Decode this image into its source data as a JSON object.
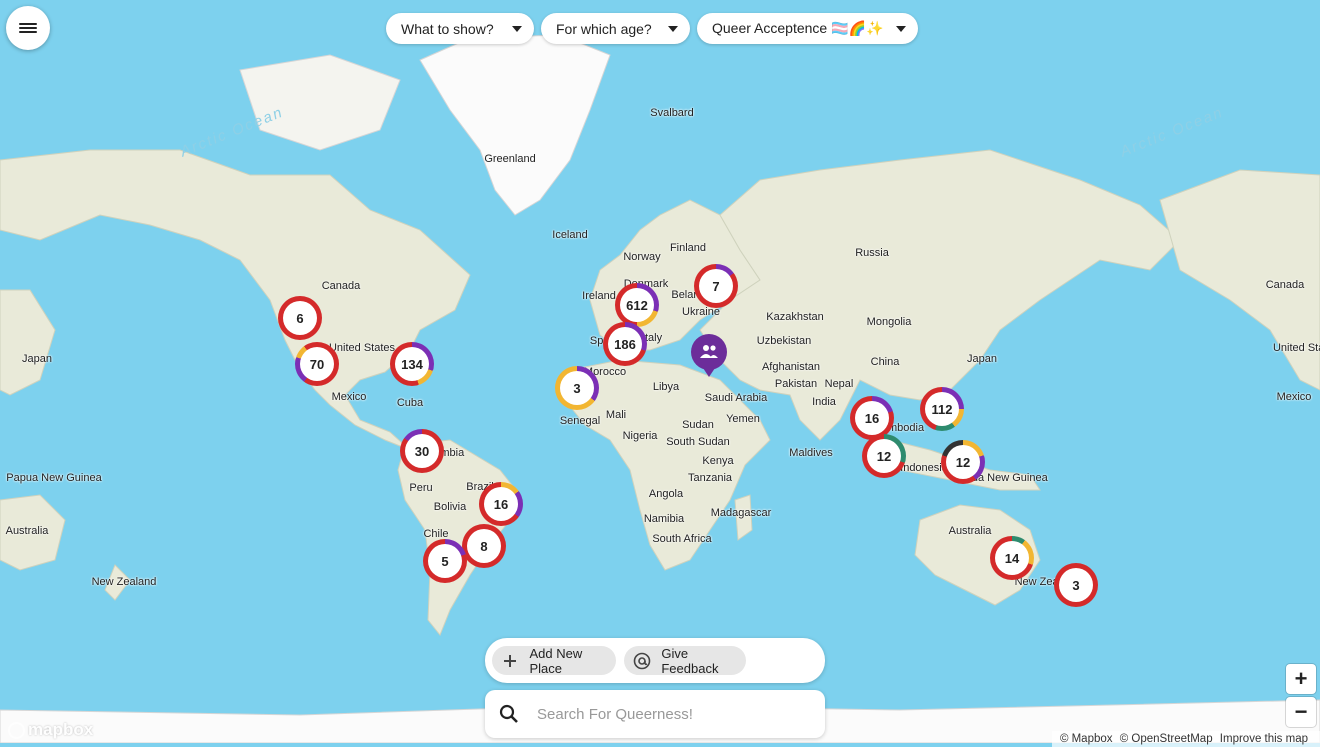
{
  "menu": {
    "icon": "hamburger-icon"
  },
  "filters": [
    {
      "label": "What to show?"
    },
    {
      "label": "For which age?"
    },
    {
      "label": "Queer Acceptence 🏳️‍⚧️🌈✨"
    }
  ],
  "oceans": [
    "Arctic Ocean",
    "Arctic Ocean"
  ],
  "places": [
    "Greenland",
    "Svalbard",
    "Iceland",
    "Norway",
    "Finland",
    "Denmark",
    "Ireland",
    "Belarus",
    "Ukraine",
    "Italy",
    "Spain",
    "Morocco",
    "Libya",
    "Mali",
    "Senegal",
    "Nigeria",
    "Sudan",
    "South Sudan",
    "Kenya",
    "Tanzania",
    "Angola",
    "Namibia",
    "Madagascar",
    "South Africa",
    "Saudi Arabia",
    "Yemen",
    "Kazakhstan",
    "Uzbekistan",
    "Afghanistan",
    "Pakistan",
    "Nepal",
    "India",
    "Maldives",
    "Russia",
    "Mongolia",
    "China",
    "Japan",
    "Cambodia",
    "Indonesia",
    "Papua New Guinea",
    "Australia",
    "New Zealand",
    "Canada",
    "United States",
    "Mexico",
    "Cuba",
    "Peru",
    "Brazil",
    "Bolivia",
    "Chile",
    "Colombia",
    "Papua New Guinea",
    "Australia",
    "Japan",
    "Canada",
    "United States",
    "Mexico",
    "New Zealand"
  ],
  "clusters": [
    {
      "count": "6"
    },
    {
      "count": "70"
    },
    {
      "count": "134"
    },
    {
      "count": "30"
    },
    {
      "count": "16"
    },
    {
      "count": "8"
    },
    {
      "count": "5"
    },
    {
      "count": "3"
    },
    {
      "count": "612"
    },
    {
      "count": "186"
    },
    {
      "count": "7"
    },
    {
      "count": "16"
    },
    {
      "count": "12"
    },
    {
      "count": "112"
    },
    {
      "count": "12"
    },
    {
      "count": "14"
    },
    {
      "count": "3"
    }
  ],
  "group_marker": {
    "icon": "group-icon"
  },
  "actions": {
    "add_label": "Add New Place",
    "feedback_label": "Give Feedback"
  },
  "search": {
    "placeholder": "Search For Queerness!"
  },
  "zoom": {
    "in": "+",
    "out": "−"
  },
  "branding": {
    "logo": "mapbox"
  },
  "attribution": [
    "© Mapbox",
    "© OpenStreetMap",
    "Improve this map"
  ],
  "colors": {
    "ocean": "#7dd1ee",
    "land": "#e9ead9",
    "ice": "#fbfbfb",
    "cluster_ring": "#d42a2a",
    "group_marker": "#6c2d9a"
  }
}
